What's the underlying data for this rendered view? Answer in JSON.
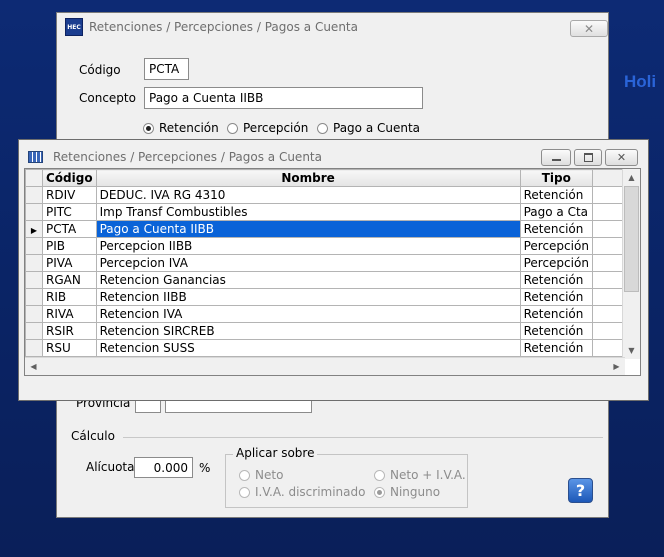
{
  "brand_text": "Holi",
  "main_window": {
    "title": "Retenciones / Percepciones / Pagos a Cuenta",
    "app_icon": "HEC",
    "codigo_label": "Código",
    "codigo_value": "PCTA",
    "concepto_label": "Concepto",
    "concepto_value": "Pago a Cuenta IIBB",
    "tipo_options": [
      {
        "label": "Retención",
        "selected": true
      },
      {
        "label": "Percepción",
        "selected": false
      },
      {
        "label": "Pago a Cuenta",
        "selected": false
      }
    ],
    "provincia_label": "Provincia",
    "calculo_label": "Cálculo",
    "alicuota_label": "Alícuota",
    "alicuota_value": "0.000",
    "percent_sign": "%",
    "aplicar_label": "Aplicar sobre",
    "aplicar_options": [
      {
        "label": "Neto",
        "selected": false
      },
      {
        "label": "Neto + I.V.A.",
        "selected": false
      },
      {
        "label": "I.V.A. discriminado",
        "selected": false
      },
      {
        "label": "Ninguno",
        "selected": true
      }
    ],
    "help_label": "?"
  },
  "lookup_window": {
    "title": "Retenciones / Percepciones / Pagos a Cuenta",
    "columns": {
      "codigo": "Código",
      "nombre": "Nombre",
      "tipo": "Tipo"
    },
    "rows": [
      {
        "codigo": "RDIV",
        "nombre": "DEDUC. IVA RG 4310",
        "tipo": "Retención"
      },
      {
        "codigo": "PITC",
        "nombre": "Imp Transf Combustibles",
        "tipo": "Pago a Cta"
      },
      {
        "codigo": "PCTA",
        "nombre": "Pago a Cuenta IIBB",
        "tipo": "Retención",
        "selected": true
      },
      {
        "codigo": "PIB",
        "nombre": "Percepcion IIBB",
        "tipo": "Percepción"
      },
      {
        "codigo": "PIVA",
        "nombre": "Percepcion IVA",
        "tipo": "Percepción"
      },
      {
        "codigo": "RGAN",
        "nombre": "Retencion Ganancias",
        "tipo": "Retención"
      },
      {
        "codigo": "RIB",
        "nombre": "Retencion IIBB",
        "tipo": "Retención"
      },
      {
        "codigo": "RIVA",
        "nombre": "Retencion IVA",
        "tipo": "Retención"
      },
      {
        "codigo": "RSIR",
        "nombre": "Retencion SIRCREB",
        "tipo": "Retención"
      },
      {
        "codigo": "RSU",
        "nombre": "Retencion SUSS",
        "tipo": "Retención"
      }
    ],
    "colors": {
      "selection": "#0a63d8"
    }
  }
}
